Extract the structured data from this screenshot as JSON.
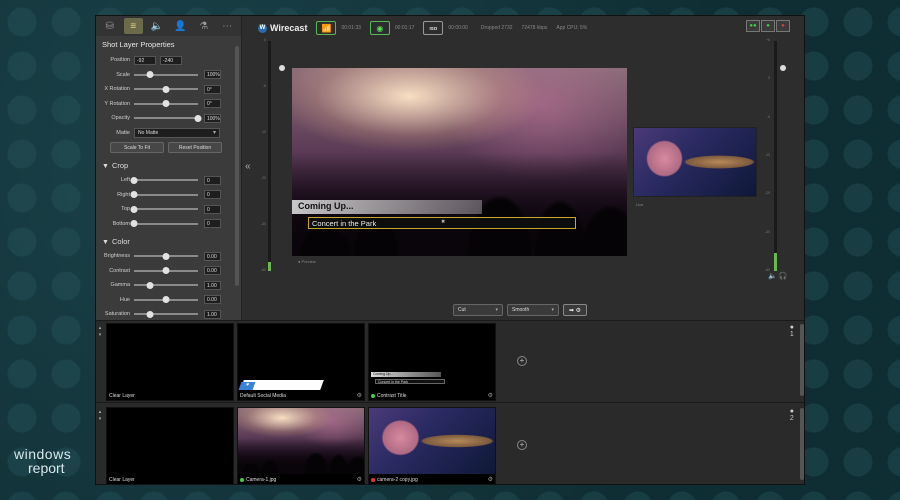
{
  "app": {
    "name": "Wirecast"
  },
  "topbar": {
    "stream_time": "00:01:33",
    "record_time": "00:01:17",
    "iso_label": "ISO",
    "iso_time": "00:00:00",
    "dropped": "Dropped 2732",
    "bitrate": "72478 kbps",
    "cpu": "App CPU: 5%",
    "rec_buttons": [
      "●●",
      "●",
      "●"
    ],
    "rec_colors": [
      "#3fd04a",
      "#3fd04a",
      "#e23b3b"
    ]
  },
  "props": {
    "tabs": [
      "⛁",
      "≡",
      "🔈",
      "👤",
      "⚗",
      "⋯"
    ],
    "title": "Shot Layer Properties",
    "position": {
      "label": "Position",
      "x": "-92",
      "y": "-240"
    },
    "sliders": [
      {
        "label": "Scale",
        "value": "100%",
        "level": 0.25
      },
      {
        "label": "X Rotation",
        "value": "0°",
        "level": 0.5
      },
      {
        "label": "Y Rotation",
        "value": "0°",
        "level": 0.5
      },
      {
        "label": "Opacity",
        "value": "100%",
        "level": 1.0
      }
    ],
    "matte": {
      "label": "Matte",
      "value": "No Matte"
    },
    "buttons": [
      "Scale To Fit",
      "Reset Position"
    ],
    "crop_title": "Crop",
    "crop": [
      {
        "label": "Left",
        "value": "0",
        "level": 0
      },
      {
        "label": "Right",
        "value": "0",
        "level": 0
      },
      {
        "label": "Top",
        "value": "0",
        "level": 0
      },
      {
        "label": "Bottom",
        "value": "0",
        "level": 0
      }
    ],
    "color_title": "Color",
    "color": [
      {
        "label": "Brightness",
        "value": "0.00",
        "level": 0.5
      },
      {
        "label": "Contrast",
        "value": "0.00",
        "level": 0.5
      },
      {
        "label": "Gamma",
        "value": "1.00",
        "level": 0.25
      },
      {
        "label": "Hue",
        "value": "0.00",
        "level": 0.5
      },
      {
        "label": "Saturation",
        "value": "1.00",
        "level": 0.25
      }
    ],
    "collapse_glyph": "«"
  },
  "meters": {
    "left_scale": [
      "0",
      "-6",
      "-10",
      "-20",
      "-40",
      "-60"
    ],
    "right_scale": [
      "+6",
      "0",
      "-6",
      "-10",
      "-20",
      "-40",
      "-60"
    ],
    "left_level": 0.04,
    "right_level": 0.08
  },
  "preview": {
    "title_text": "Coming Up...",
    "subtitle_text": "Concert in the Park",
    "close_glyph": "✖",
    "label": "● Preview"
  },
  "live": {
    "label": "Live"
  },
  "audio_icons": {
    "speaker": "🔈",
    "headphones": "🎧"
  },
  "transition": {
    "mode": "Cut",
    "style": "Smooth",
    "go": "➡ ⚙"
  },
  "layers": [
    {
      "number": "1",
      "shots": [
        {
          "label": "Clear Layer",
          "type": "clear",
          "dot": ""
        },
        {
          "label": "Default Social Media",
          "type": "social",
          "dot": ""
        },
        {
          "label": "Contrast Title",
          "type": "title",
          "dot": "#3fd04a",
          "title_line": "Coming Up...",
          "sub_line": "Concert in the Park"
        }
      ]
    },
    {
      "number": "2",
      "shots": [
        {
          "label": "Clear Layer",
          "type": "clear",
          "dot": ""
        },
        {
          "label": "Camera-1.jpg",
          "type": "concert",
          "dot": "#3fd04a"
        },
        {
          "label": "camera-2 copy.jpg",
          "type": "guitar",
          "dot": "#e23b3b"
        }
      ]
    }
  ],
  "watermark": {
    "line1": "windows",
    "line2": "report"
  }
}
